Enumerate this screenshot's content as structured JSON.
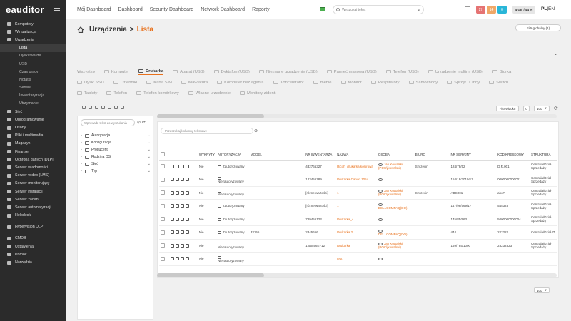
{
  "app": {
    "logo": "eauditor"
  },
  "sidebar": {
    "items": [
      {
        "label": "Komputery",
        "type": "top"
      },
      {
        "label": "Wirtualizacja",
        "type": "top"
      },
      {
        "label": "Urządzenia",
        "type": "top"
      },
      {
        "label": "Lista",
        "type": "sub",
        "active": true
      },
      {
        "label": "Dyski twarde",
        "type": "sub"
      },
      {
        "label": "USB",
        "type": "sub"
      },
      {
        "label": "Czas pracy",
        "type": "sub"
      },
      {
        "label": "Notatki",
        "type": "sub"
      },
      {
        "label": "Serwis",
        "type": "sub"
      },
      {
        "label": "Inwentaryzacja",
        "type": "sub"
      },
      {
        "label": "Utrzymanie",
        "type": "sub"
      },
      {
        "label": "Sieć",
        "type": "top"
      },
      {
        "label": "Oprogramowanie",
        "type": "top"
      },
      {
        "label": "Osoby",
        "type": "top"
      },
      {
        "label": "Pliki i multimedia",
        "type": "top"
      },
      {
        "label": "Magazyn",
        "type": "top"
      },
      {
        "label": "Finanse",
        "type": "top"
      },
      {
        "label": "Ochrona danych [DLP]",
        "type": "top"
      },
      {
        "label": "Serwer wiadomości",
        "type": "top"
      },
      {
        "label": "Serwer wideo (LMS)",
        "type": "top"
      },
      {
        "label": "Serwer monitorujący",
        "type": "top"
      },
      {
        "label": "Serwer instalacji",
        "type": "top"
      },
      {
        "label": "Serwer zadań",
        "type": "top"
      },
      {
        "label": "Serwer automatyzacji",
        "type": "top"
      },
      {
        "label": "Helpdesk",
        "type": "top"
      },
      {
        "label": "Hypervision DLP",
        "type": "top",
        "gap": true
      },
      {
        "label": "CMDB",
        "type": "top",
        "gap": true
      },
      {
        "label": "Ustawienia",
        "type": "top"
      },
      {
        "label": "Pomoc",
        "type": "top"
      },
      {
        "label": "Narzędzia",
        "type": "top"
      }
    ]
  },
  "topnav": [
    "Mój Dashboard",
    "Dashboard",
    "Security Dashboard",
    "Network Dashboard",
    "Raporty"
  ],
  "search": {
    "placeholder": "Wyszukaj tekst"
  },
  "badges": [
    {
      "value": "27",
      "color": "#e57373"
    },
    {
      "value": "14",
      "color": "#f0a868"
    },
    {
      "value": "0",
      "color": "#29b6d8"
    }
  ],
  "memory": "4 GB / 44 %",
  "lang": {
    "active": "PL",
    "sep": "|",
    "other": "EN"
  },
  "breadcrumb": {
    "parent": "Urządzenia",
    "sep": ">",
    "current": "Lista"
  },
  "global_filter": "Filtr globalny (1)",
  "tabs_row1": [
    "Wszystko",
    "Komputer",
    "Drukarka",
    "Aparat (USB)",
    "Dyktafon (USB)",
    "Nieznane urządzenie (USB)",
    "Pamięć masowa (USB)",
    "Telefon (USB)",
    "Urządzenie multim. (USB)",
    "Biurka"
  ],
  "tabs_row2": [
    "Dyski SSD",
    "Dzienniki",
    "Karta SIM",
    "Klawiatura",
    "Komputer bez agenta",
    "Koncentrator",
    "meble",
    "Monitor",
    "Respiratory",
    "Samochody",
    "Sprzęt IT Inny",
    "Switch"
  ],
  "tabs_row3": [
    "Tablety",
    "Telefon",
    "Telefon komórkowy",
    "Własne urządzenie",
    "Monitory zident."
  ],
  "active_tab": "Drukarka",
  "filter_view": "Filtr widoku",
  "count": "0",
  "page_size": "100",
  "left_search": {
    "placeholder": "Wprowadź tekst do wyszukania"
  },
  "tree": [
    "Autoryzacja",
    "Konfiguracja",
    "Producent",
    "Rodzina OS",
    "Sieć",
    "Typ"
  ],
  "column_filter": {
    "placeholder": "Przeszukaj kolumny tekstowe"
  },
  "columns": [
    "",
    "",
    "WYKRYTY",
    "AUTORYZACJA",
    "MODEL",
    "NR INWENTARZA",
    "NAZWA",
    "OSOBA",
    "BIURO",
    "NR SERYJNY",
    "KOD KRESKOWY",
    "STRUKTURA"
  ],
  "rows": [
    {
      "wykryty": "Nie",
      "auth": "Zautoryzowany",
      "model": "",
      "nr_inw": "432765327",
      "nazwa": "Ricoh_drukarka kolorowa",
      "osoba": "Jan Kowalski (POC\\jkowalski)",
      "biuro": "Szczecin",
      "nr_ser": "124/78/52",
      "kod": "D.R.001",
      "struktura": "Centrala/Dział Sprzedaży"
    },
    {
      "wykryty": "Nie",
      "auth": "Niezautoryzowany",
      "model": "",
      "nr_inw": "123456789",
      "nazwa": "Drukarka Canon 1054",
      "osoba": "",
      "biuro": "",
      "nr_ser": "154/18/2019/17",
      "kod": "0000000000001",
      "struktura": "Centrala/Dział Sprzedaży"
    },
    {
      "wykryty": "Nie",
      "auth": "Niezautoryzowany",
      "model": "",
      "nr_inw": "[różne wartości]",
      "nazwa": "1",
      "osoba": "Jan Kowalski (POC\\jkowalski)",
      "biuro": "Szczecin",
      "nr_ser": "ABC001",
      "kod": "abc#",
      "struktura": "Centrala/Dział Sprzedaży"
    },
    {
      "wykryty": "Nie",
      "auth": "Zautoryzowany",
      "model": "",
      "nr_inw": "[różne wartości]",
      "nazwa": "1",
      "osoba": "DELLCOMPAQ(DO)",
      "biuro": "",
      "nr_ser": "147/98/569/17",
      "kod": "545323",
      "struktura": "Centrala/Dział Sprzedaży"
    },
    {
      "wykryty": "Nie",
      "auth": "Zautoryzowany",
      "model": "",
      "nr_inw": "789456123",
      "nazwa": "Drukarka_4",
      "osoba": "",
      "biuro": "",
      "nr_ser": "145/85/963",
      "kod": "5000000000004",
      "struktura": "Centrala/Dział Sprzedaży"
    },
    {
      "wykryty": "Nie",
      "auth": "Zautoryzowany",
      "model": "33155",
      "nr_inw": "2345656",
      "nazwa": "Drukarka 2",
      "osoba": "DELLCOMPAQ(DO)",
      "biuro": "",
      "nr_ser": "444",
      "kod": "222222",
      "struktura": "Centrala/Dział IT"
    },
    {
      "wykryty": "Nie",
      "auth": "Niezautoryzowany",
      "model": "",
      "nr_inw": "1,55556E+12",
      "nazwa": "Drukarka",
      "osoba": "Jan Kowalski (POC\\jkowalski)",
      "biuro": "",
      "nr_ser": "159/785/1000",
      "kod": "23232323",
      "struktura": "Centrala/Dział Sprzedaży"
    },
    {
      "wykryty": "Nie",
      "auth": "Niezautoryzowany",
      "model": "",
      "nr_inw": "",
      "nazwa": "test",
      "osoba": "",
      "biuro": "",
      "nr_ser": "",
      "kod": "",
      "struktura": ""
    }
  ],
  "colors": {
    "accent": "#e8711c",
    "sidebar": "#2b2b2b"
  }
}
